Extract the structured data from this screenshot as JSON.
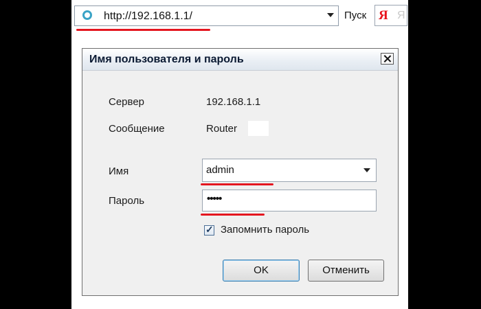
{
  "browser": {
    "url": "http://192.168.1.1/",
    "go_label": "Пуск",
    "yandex_logo": "Я",
    "yandex_ghost": "Я"
  },
  "dialog": {
    "title": "Имя пользователя и пароль",
    "server_label": "Сервер",
    "server_value": "192.168.1.1",
    "message_label": "Сообщение",
    "message_value": "Router",
    "name_label": "Имя",
    "name_value": "admin",
    "password_label": "Пароль",
    "password_value": "•••••",
    "remember_label": "Запомнить пароль",
    "remember_checked": true,
    "ok_label": "OK",
    "cancel_label": "Отменить"
  },
  "colors": {
    "highlight_underline": "#e4161f",
    "background": "#000000"
  }
}
